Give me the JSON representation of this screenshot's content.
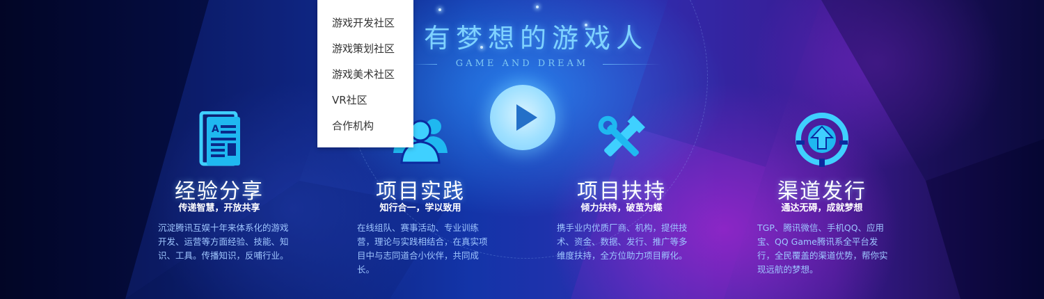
{
  "hero": {
    "title": "有梦想的游戏人",
    "subtitle": "GAME AND DREAM"
  },
  "play_button": {
    "icon": "play-icon"
  },
  "features": [
    {
      "icon": "document-icon",
      "title": "经验分享",
      "subtitle": "传递智慧，开放共享",
      "desc": "沉淀腾讯互娱十年来体系化的游戏开发、运营等方面经验、技能、知识、工具。传播知识，反哺行业。"
    },
    {
      "icon": "team-icon",
      "title": "项目实践",
      "subtitle": "知行合一，学以致用",
      "desc": "在线组队、赛事活动、专业训练营，理论与实践相结合，在真实项目中与志同道合小伙伴，共同成长。"
    },
    {
      "icon": "tools-icon",
      "title": "项目扶持",
      "subtitle": "倾力扶持，破茧为蝶",
      "desc": "携手业内优质厂商、机构，提供技术、资金、数据、发行、推广等多维度扶持，全方位助力项目孵化。"
    },
    {
      "icon": "publish-icon",
      "title": "渠道发行",
      "subtitle": "通达无碍，成就梦想",
      "desc": "TGP、腾讯微信、手机QQ、应用宝、QQ Game腾讯系全平台发行，全民覆盖的渠道优势，帮你实现远航的梦想。"
    }
  ],
  "dropdown": {
    "items": [
      "游戏开发社区",
      "游戏策划社区",
      "游戏美术社区",
      "VR社区",
      "合作机构"
    ]
  },
  "colors": {
    "accent": "#7fd2ff",
    "desc_text": "#9fc6ff",
    "dropdown_bg": "#ffffff",
    "dropdown_text": "#333333"
  }
}
